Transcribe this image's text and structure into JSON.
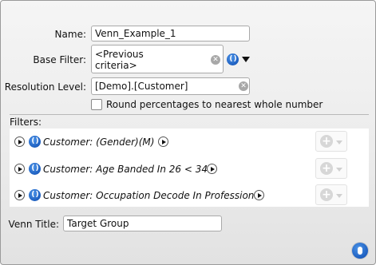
{
  "name": {
    "label": "Name:",
    "value": "Venn_Example_1"
  },
  "base_filter": {
    "label": "Base Filter:",
    "value": "<Previous\ncriteria>"
  },
  "resolution": {
    "label": "Resolution Level:",
    "value": "[Demo].[Customer]"
  },
  "round_option": {
    "label": "Round percentages to nearest whole number",
    "checked": false
  },
  "filters": {
    "label": "Filters:",
    "items": [
      {
        "text": "Customer: (Gender)(M)"
      },
      {
        "text": "Customer: Age Banded In 26 < 34"
      },
      {
        "text": "Customer: Occupation Decode In Professional"
      }
    ]
  },
  "venn_title": {
    "label": "Venn Title:",
    "value": "Target Group"
  },
  "icons": {
    "clear": "clear-icon",
    "paren": "parenthesis-icon",
    "expand": "play-icon",
    "add": "add-icon"
  },
  "colors": {
    "accent": "#1d5fc0"
  }
}
